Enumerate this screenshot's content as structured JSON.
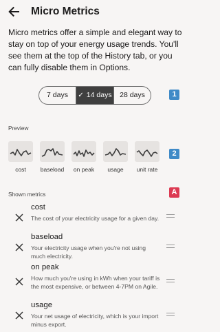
{
  "appbar": {
    "title": "Micro Metrics"
  },
  "intro": "Micro metrics offer a simple and elegant way to stay on top of your energy usage trends. You'll see them at the top of the History tab, or you can fully disable them in Options.",
  "range": {
    "options": [
      "7 days",
      "14 days",
      "28 days"
    ],
    "selected": "14 days",
    "badge": "1"
  },
  "preview": {
    "label": "Preview",
    "badge": "2",
    "items": [
      {
        "label": "cost",
        "icon": "cost-sparkline-icon"
      },
      {
        "label": "baseload",
        "icon": "baseload-sparkline-icon"
      },
      {
        "label": "on peak",
        "icon": "on-peak-sparkline-icon"
      },
      {
        "label": "usage",
        "icon": "usage-sparkline-icon"
      },
      {
        "label": "unit rate",
        "icon": "unit-rate-sparkline-icon"
      }
    ]
  },
  "shown": {
    "label": "Shown metrics",
    "badge": "A",
    "metrics": [
      {
        "name": "cost",
        "description": "The cost of your electricity usage for a given day."
      },
      {
        "name": "baseload",
        "description": "Your electricity usage when you're not using much electricity."
      },
      {
        "name": "on peak",
        "description": "How much you're using in kWh when your tariff is the most expensive, or between 4-7PM on Agile."
      },
      {
        "name": "usage",
        "description": "Your net usage of electricity, which is your import minus export."
      }
    ]
  },
  "colors": {
    "selected_segment": "#3f3f3f",
    "badge_blue": "#3f8ac7",
    "badge_red": "#dc3a52",
    "background": "#f7f5f4"
  }
}
